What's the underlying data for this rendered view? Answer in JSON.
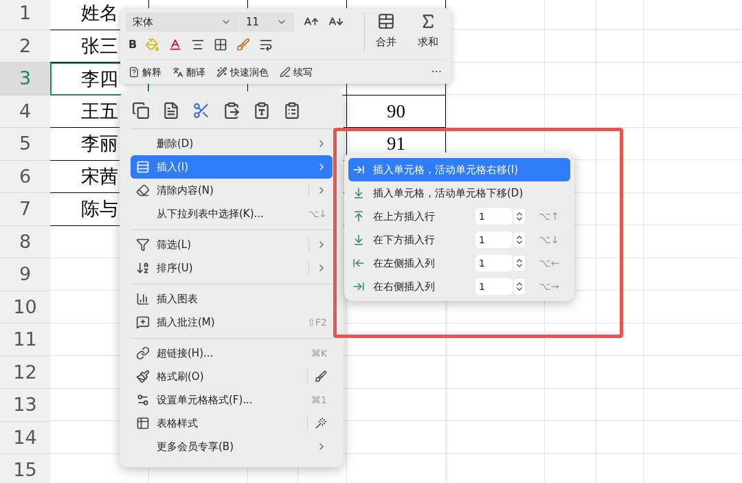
{
  "sheet": {
    "rows": [
      {
        "number": "1",
        "selected": false,
        "column_1": "姓名"
      },
      {
        "number": "2",
        "selected": false,
        "column_1": "张三"
      },
      {
        "number": "3",
        "selected": true,
        "column_1": "李四"
      },
      {
        "number": "4",
        "selected": false,
        "column_1": "王五",
        "column_4": "90"
      },
      {
        "number": "5",
        "selected": false,
        "column_1": "李丽",
        "column_4": "91"
      },
      {
        "number": "6",
        "selected": false,
        "column_1": "宋茜"
      },
      {
        "number": "7",
        "selected": false,
        "column_1": "陈与"
      },
      {
        "number": "8",
        "selected": false
      },
      {
        "number": "9",
        "selected": false
      },
      {
        "number": "10",
        "selected": false
      },
      {
        "number": "11",
        "selected": false
      },
      {
        "number": "12",
        "selected": false
      },
      {
        "number": "13",
        "selected": false
      },
      {
        "number": "14",
        "selected": false
      },
      {
        "number": "15",
        "selected": false
      }
    ]
  },
  "toolbar": {
    "font": "宋体",
    "size": "11",
    "bold": "B",
    "merge": "合并",
    "sum": "求和",
    "ai_tools": [
      "解释",
      "翻译",
      "快速润色",
      "续写"
    ],
    "more": "···"
  },
  "context_menu": {
    "sections": [
      [
        {
          "label": "删除(D)",
          "has_submenu": true,
          "split": false,
          "selected": false
        },
        {
          "label": "插入(I)",
          "has_submenu": true,
          "split": false,
          "selected": true
        },
        {
          "label": "清除内容(N)",
          "has_submenu": true,
          "split": true,
          "selected": false
        },
        {
          "label": "从下拉列表中选择(K)...",
          "shortcut": "⌥↓",
          "has_submenu": false,
          "split": false,
          "selected": false
        }
      ],
      [
        {
          "label": "筛选(L)",
          "has_submenu": true,
          "split": true,
          "selected": false
        },
        {
          "label": "排序(U)",
          "has_submenu": true,
          "split": true,
          "selected": false
        }
      ],
      [
        {
          "label": "插入图表",
          "has_submenu": false,
          "split": false,
          "selected": false
        },
        {
          "label": "插入批注(M)",
          "shortcut": "⇧F2",
          "has_submenu": false,
          "split": false,
          "selected": false
        }
      ],
      [
        {
          "label": "超链接(H)...",
          "shortcut": "⌘K",
          "has_submenu": false,
          "split": false,
          "selected": false
        },
        {
          "label": "格式刷(O)",
          "has_submenu": false,
          "split": true,
          "selected": false
        },
        {
          "label": "设置单元格格式(F)...",
          "shortcut": "⌘1",
          "has_submenu": false,
          "split": false,
          "selected": false
        },
        {
          "label": "表格样式",
          "has_submenu": false,
          "split": true,
          "selected": false
        },
        {
          "label": "更多会员专享(B)",
          "has_submenu": true,
          "split": false,
          "selected": false
        }
      ]
    ]
  },
  "submenu": {
    "items": [
      {
        "kind": "action",
        "label": "插入单元格，活动单元格右移(I)",
        "selected": true
      },
      {
        "kind": "action",
        "label": "插入单元格，活动单元格下移(D)",
        "selected": false
      },
      {
        "kind": "count",
        "label": "在上方插入行",
        "value": "1",
        "shortcut": "⌥↑",
        "selected": false
      },
      {
        "kind": "count",
        "label": "在下方插入行",
        "value": "1",
        "shortcut": "⌥↓",
        "selected": false
      },
      {
        "kind": "count",
        "label": "在左侧插入列",
        "value": "1",
        "shortcut": "⌥←",
        "selected": false
      },
      {
        "kind": "count",
        "label": "在右侧插入列",
        "value": "1",
        "shortcut": "⌥→",
        "selected": false
      }
    ]
  }
}
